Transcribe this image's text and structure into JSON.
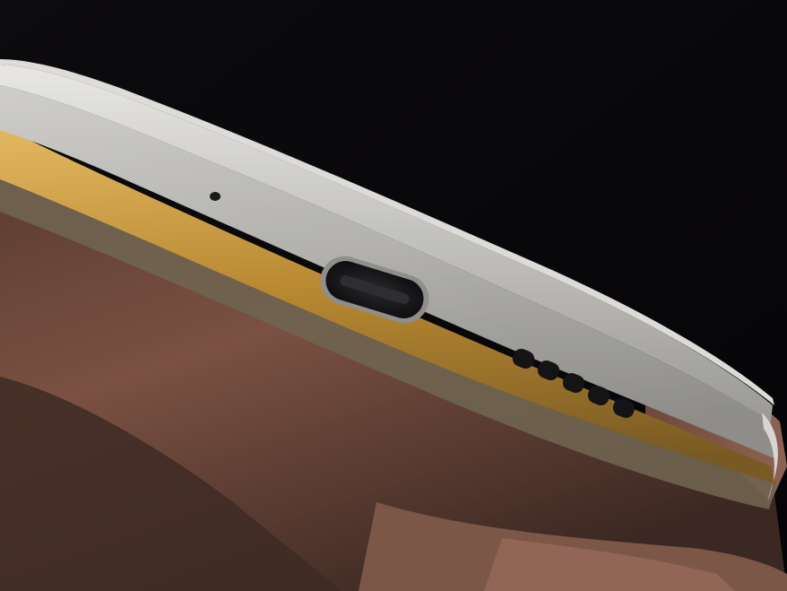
{
  "scene": {
    "subject": "smartphone-bottom-edge",
    "colors": {
      "background": "#070608",
      "aluminum_light": "#c9c8c6",
      "aluminum_mid": "#a9a8a6",
      "aluminum_dark": "#7e7d7b",
      "gold_trim": "#b98a2e",
      "gold_trim_light": "#e0b45a",
      "skin_shadow": "#3a2620",
      "skin_mid": "#6b4538",
      "skin_light": "#8a5d4c",
      "port_inner": "#161618"
    },
    "speaker_holes": 5
  }
}
